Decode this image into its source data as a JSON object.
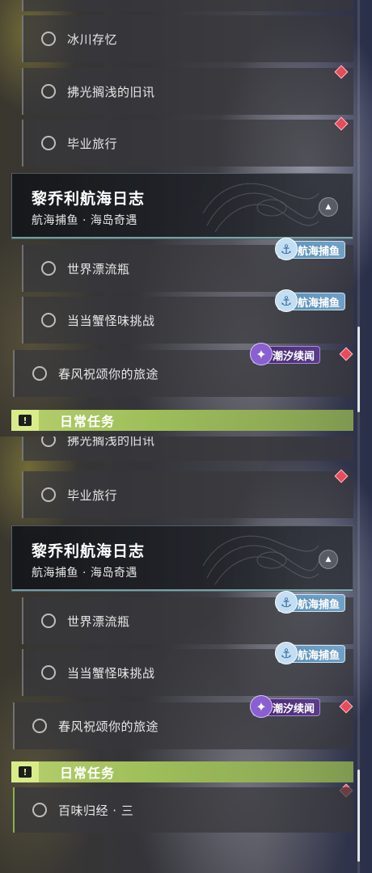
{
  "top_panel": {
    "quests_before": [
      {
        "label": "冰川存忆"
      },
      {
        "label": "拂光搁浅的旧讯"
      },
      {
        "label": "毕业旅行"
      }
    ],
    "section": {
      "title": "黎乔利航海日志",
      "subtitle": "航海捕鱼 · 海岛奇遇",
      "collapse_icon": "chevron-up-icon"
    },
    "quests_after": [
      {
        "label": "世界漂流瓶",
        "tag": "航海捕鱼"
      },
      {
        "label": "当当蟹怪味挑战",
        "tag": "航海捕鱼"
      },
      {
        "label": "春风祝颂你的旅途",
        "tag": "潮汐续闻"
      }
    ],
    "daily_header": {
      "label": "日常任务"
    }
  },
  "bottom_panel": {
    "quests_before": [
      {
        "label": "拂光搁浅的旧讯"
      },
      {
        "label": "毕业旅行"
      }
    ],
    "section": {
      "title": "黎乔利航海日志",
      "subtitle": "航海捕鱼 · 海岛奇遇",
      "collapse_icon": "chevron-up-icon"
    },
    "quests_after": [
      {
        "label": "世界漂流瓶",
        "tag": "航海捕鱼"
      },
      {
        "label": "当当蟹怪味挑战",
        "tag": "航海捕鱼"
      },
      {
        "label": "春风祝颂你的旅途",
        "tag": "潮汐续闻"
      }
    ],
    "daily_header": {
      "label": "日常任务",
      "icon_glyph": "!"
    },
    "daily_quests": [
      {
        "label": "百味归经 · 三"
      }
    ]
  },
  "colors": {
    "tracked_marker": "#e84b5a",
    "daily_accent": "#9fbf5a",
    "section_accent": "#96dcdc"
  }
}
